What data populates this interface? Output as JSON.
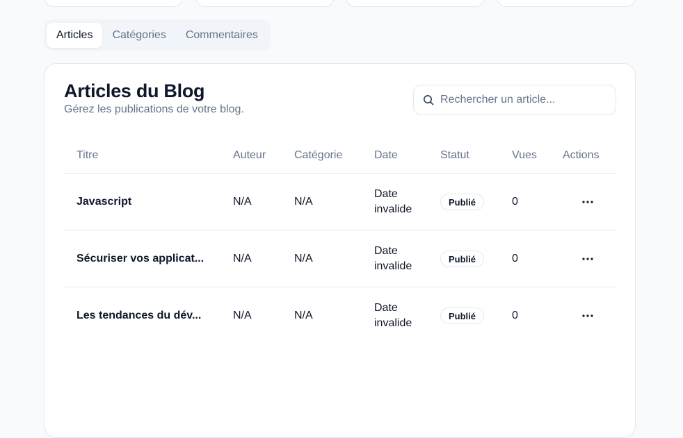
{
  "tabs": [
    {
      "label": "Articles",
      "active": true
    },
    {
      "label": "Catégories",
      "active": false
    },
    {
      "label": "Commentaires",
      "active": false
    }
  ],
  "card": {
    "title": "Articles du Blog",
    "subtitle": "Gérez les publications de votre blog."
  },
  "search": {
    "placeholder": "Rechercher un article...",
    "value": "",
    "icon": "search-icon"
  },
  "table": {
    "headers": {
      "titre": "Titre",
      "auteur": "Auteur",
      "categorie": "Catégorie",
      "date": "Date",
      "statut": "Statut",
      "vues": "Vues",
      "actions": "Actions"
    },
    "rows": [
      {
        "titre": "Javascript",
        "auteur": "N/A",
        "categorie": "N/A",
        "date": "Date invalide",
        "statut": "Publié",
        "vues": "0"
      },
      {
        "titre": "Sécuriser vos applicat...",
        "auteur": "N/A",
        "categorie": "N/A",
        "date": "Date invalide",
        "statut": "Publié",
        "vues": "0"
      },
      {
        "titre": "Les tendances du dév...",
        "auteur": "N/A",
        "categorie": "N/A",
        "date": "Date invalide",
        "statut": "Publié",
        "vues": "0"
      }
    ]
  },
  "colors": {
    "page_bg": "#f8fafc",
    "border": "#e2e8f0",
    "muted_text": "#64748b",
    "text": "#0f172a"
  }
}
